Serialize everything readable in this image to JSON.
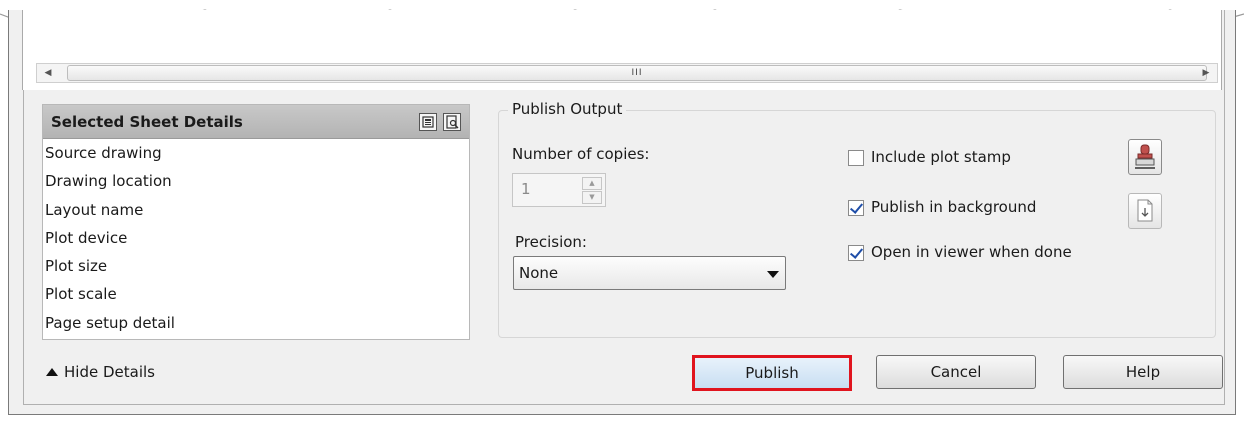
{
  "scrollbar": {
    "thumb_grip": "III"
  },
  "details": {
    "title": "Selected Sheet Details",
    "rows": [
      "Source drawing",
      "Drawing location",
      "Layout name",
      "Plot device",
      "Plot size",
      "Plot scale",
      "Page setup detail"
    ]
  },
  "publish_output": {
    "legend": "Publish Output",
    "copies_label": "Number of copies:",
    "copies_value": "1",
    "precision_label": "Precision:",
    "precision_value": "None",
    "options": [
      {
        "label": "Include plot stamp",
        "checked": false
      },
      {
        "label": "Publish in background",
        "checked": true
      },
      {
        "label": "Open in viewer when done",
        "checked": true
      }
    ],
    "icons": [
      "plot-stamp-icon",
      "stamp-settings-icon"
    ]
  },
  "footer": {
    "hide_details": "Hide Details",
    "publish": "Publish",
    "cancel": "Cancel",
    "help": "Help"
  },
  "colors": {
    "highlight_border": "#e0141e",
    "checkmark": "#1f4ea8"
  }
}
